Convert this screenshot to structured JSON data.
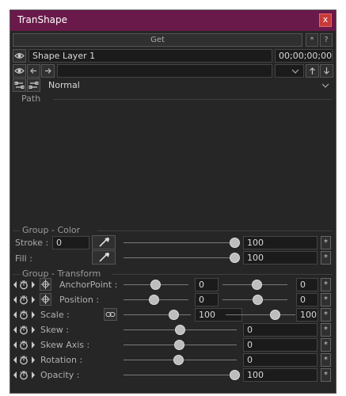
{
  "window": {
    "title": "TranShape",
    "close_label": "x"
  },
  "top": {
    "get_label": "Get",
    "star_label": "*",
    "help_label": "?",
    "layer_name": "Shape Layer 1",
    "timecode": "00;00;00;00",
    "blend_mode": "Normal"
  },
  "path_section": {
    "label": "Path"
  },
  "color_group": {
    "label": "Group - Color",
    "stroke": {
      "label": "Stroke :",
      "width": "0",
      "value": "100",
      "level": 100
    },
    "fill": {
      "label": "Fill :",
      "value": "100",
      "level": 100
    },
    "star_label": "*"
  },
  "transform_group": {
    "label": "Group - Transform",
    "rows": [
      {
        "label": "AnchorPoint :",
        "v1": "0",
        "v2": "0"
      },
      {
        "label": "Position :",
        "v1": "0",
        "v2": "0"
      },
      {
        "label": "Scale :",
        "v1": "100",
        "v2": "100"
      },
      {
        "label": "Skew :",
        "v1": "0"
      },
      {
        "label": "Skew Axis :",
        "v1": "0"
      },
      {
        "label": "Rotation :",
        "v1": "0"
      },
      {
        "label": "Opacity :",
        "v1": "100"
      }
    ],
    "star_label": "*"
  },
  "colors": {
    "title_bar": "#6a1a4a",
    "background": "#262626",
    "close": "#c83a3a"
  },
  "icons": [
    "eye-icon",
    "arrow-left-icon",
    "arrow-right-icon",
    "chevron-down-icon",
    "arrow-up-icon",
    "arrow-down-icon",
    "eyedropper-icon",
    "stopwatch-icon",
    "keyframe-nav-icon",
    "link-icon",
    "anchor-target-icon"
  ]
}
